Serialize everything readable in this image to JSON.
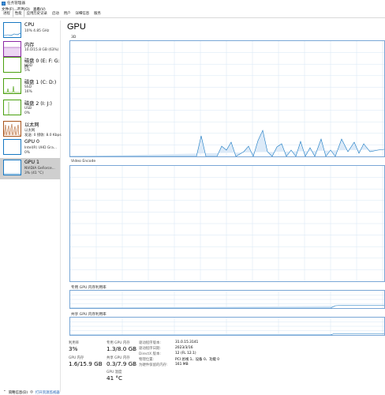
{
  "window": {
    "title": "任务管理器"
  },
  "menu": {
    "items": [
      "文件(F)",
      "选项(O)",
      "查看(V)"
    ]
  },
  "tabs": [
    "进程",
    "性能",
    "应用历史记录",
    "启动",
    "用户",
    "详细信息",
    "服务"
  ],
  "sidebar": {
    "items": [
      {
        "name": "CPU",
        "sub1": "10% 4.85 GHz",
        "sub2": "",
        "color": "#1778c2"
      },
      {
        "name": "内存",
        "sub1": "10.0/15.8 GB (63%)",
        "sub2": "",
        "color": "#8b29a5"
      },
      {
        "name": "磁盘 0 (E: F: G: H:",
        "sub1": "HDD",
        "sub2": "5%",
        "color": "#4aa00e"
      },
      {
        "name": "磁盘 1 (C: D:)",
        "sub1": "SSD",
        "sub2": "16%",
        "color": "#4aa00e"
      },
      {
        "name": "磁盘 2 (I: J:)",
        "sub1": "USB",
        "sub2": "0%",
        "color": "#4aa00e"
      },
      {
        "name": "以太网",
        "sub1": "以太网",
        "sub2": "发送: 0 接收: 8.0 Kbps",
        "color": "#a8541a"
      },
      {
        "name": "GPU 0",
        "sub1": "Intel(R) UHD Gra...",
        "sub2": "0%",
        "color": "#1778c2"
      },
      {
        "name": "GPU 1",
        "sub1": "NVIDIA GeForce...",
        "sub2": "3% (41 °C)",
        "color": "#1778c2"
      }
    ]
  },
  "main": {
    "title": "GPU",
    "engine1": "3D",
    "engine2": "Video Encode",
    "dedicated_label": "专用 GPU 内存利用率",
    "shared_label": "共享 GPU 内存利用率"
  },
  "stats": {
    "util_label": "利用率",
    "util_value": "3%",
    "ded_label": "专用 GPU 内存",
    "ded_value": "1.3/8.0 GB",
    "gpu_mem_label": "GPU 内存",
    "gpu_mem_value": "1.6/15.9 GB",
    "shared_label": "共享 GPU 内存",
    "shared_value": "0.3/7.9 GB",
    "temp_label": "GPU 温度",
    "temp_value": "41 °C"
  },
  "info": [
    {
      "label": "驱动程序版本:",
      "value": "31.0.15.3141"
    },
    {
      "label": "驱动程序日期:",
      "value": "2023/3/16"
    },
    {
      "label": "DirectX 版本:",
      "value": "12 (FL 12.1)"
    },
    {
      "label": "物理位置:",
      "value": "PCI 总线 1、设备 0、功能 0"
    },
    {
      "label": "为硬件保留的内存:",
      "value": "161 MB"
    }
  ],
  "footer": {
    "less": "简略信息(D)",
    "open": "打开资源监视器"
  },
  "colors": {
    "gpu_line": "#1778c2",
    "graph_border": "#7aa7d6",
    "grid": "#d6e6f5"
  }
}
